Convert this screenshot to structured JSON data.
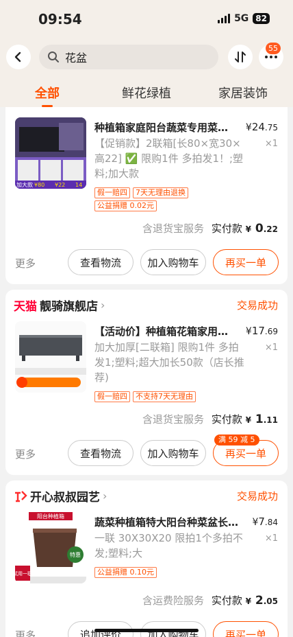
{
  "status": {
    "time": "09:54",
    "network": "5G",
    "battery": "82"
  },
  "search": {
    "query": "花盆"
  },
  "header": {
    "badge_count": "55"
  },
  "tabs": [
    {
      "label": "全部",
      "active": true
    },
    {
      "label": "鲜花绿植",
      "active": false
    },
    {
      "label": "家居装饰",
      "active": false
    }
  ],
  "orders": [
    {
      "title": "种植箱家庭阳台蔬菜专用菜…",
      "price_symbol": "¥",
      "price_int": "24",
      "price_dec": ".75",
      "qty": "×1",
      "spec": "【促销款】2联箱[长80×宽30×高22] ✅ 限购1件 多拍发1！;塑料;加大款",
      "tags": [
        "假一赔四",
        "7天无理由退换"
      ],
      "tags2": [
        "公益捐赠 0.02元"
      ],
      "service": "含退货宝服务",
      "paid_label": "实付款",
      "paid_symbol": "¥",
      "paid_int": "0",
      "paid_dec": ".22",
      "more": "更多",
      "btn1": "查看物流",
      "btn2": "加入购物车",
      "btn3": "再买一单"
    },
    {
      "shop_logo": "天猫",
      "shop": "靓骑旗舰店",
      "status": "交易成功",
      "title": "【活动价】种植箱花箱家用…",
      "price_symbol": "¥",
      "price_int": "17",
      "price_dec": ".69",
      "qty": "×1",
      "spec": "加大加厚[二联箱] 限购1件 多拍发1;塑料;超大加长50款（店长推荐)",
      "tags": [
        "假一赔四",
        "不支持7天无理由"
      ],
      "service": "含退货宝服务",
      "paid_label": "实付款",
      "paid_symbol": "¥",
      "paid_int": "1",
      "paid_dec": ".11",
      "more": "更多",
      "btn1": "查看物流",
      "btn2": "加入购物车",
      "btn3": "再买一单",
      "promo": "满 59 减 5"
    },
    {
      "shop": "开心叔叔园艺",
      "status": "交易成功",
      "title": "蔬菜种植箱特大阳台种菜盆长…",
      "price_symbol": "¥",
      "price_int": "7",
      "price_dec": ".84",
      "qty": "×1",
      "spec": "一联 30X30X20 限拍1个多拍不发;塑料;大",
      "tags": [
        "公益捐赠 0.10元"
      ],
      "service": "含运费险服务",
      "paid_label": "实付款",
      "paid_symbol": "¥",
      "paid_int": "2",
      "paid_dec": ".05",
      "more": "更多",
      "btn1": "追加评价",
      "btn2": "加入购物车",
      "btn3": "再买一单"
    }
  ],
  "thumbs": {
    "t1_labels": [
      "加大款",
      "¥80",
      "¥22",
      "14"
    ],
    "t3_labels": [
      "阳台种植箱",
      "特惠",
      "试用一联"
    ]
  }
}
